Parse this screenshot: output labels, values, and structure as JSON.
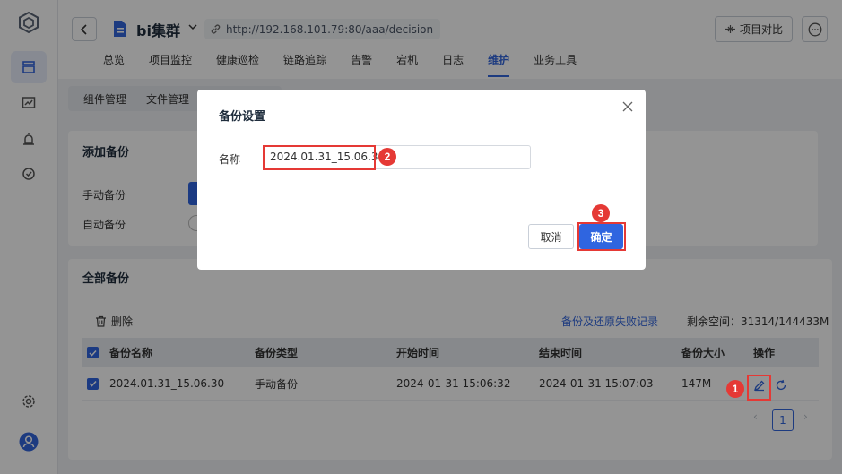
{
  "app": {
    "cluster_name": "bi集群",
    "url": "http://192.168.101.79:80/aaa/decision",
    "compare_label": "项目对比"
  },
  "nav_tabs": [
    "总览",
    "项目监控",
    "健康巡检",
    "链路追踪",
    "告警",
    "宕机",
    "日志",
    "维护",
    "业务工具"
  ],
  "active_tab": "维护",
  "sub_tabs": [
    "组件管理",
    "文件管理"
  ],
  "add_backup": {
    "title": "添加备份",
    "manual_label": "手动备份",
    "auto_label": "自动备份"
  },
  "all_backups": {
    "title": "全部备份",
    "delete_label": "删除",
    "fail_link": "备份及还原失败记录",
    "space_text": "剩余空间：31314/144433M",
    "columns": [
      "备份名称",
      "备份类型",
      "开始时间",
      "结束时间",
      "备份大小",
      "操作"
    ],
    "rows": [
      {
        "name": "2024.01.31_15.06.30",
        "type": "手动备份",
        "start": "2024-01-31 15:06:32",
        "end": "2024-01-31 15:07:03",
        "size": "147M"
      }
    ],
    "page": "1"
  },
  "modal": {
    "title": "备份设置",
    "name_label": "名称",
    "name_value": "2024.01.31_15.06.30",
    "cancel_label": "取消",
    "ok_label": "确定"
  },
  "steps": [
    "1",
    "2",
    "3"
  ],
  "colors": {
    "primary": "#2f65e0",
    "highlight": "#e53935"
  }
}
